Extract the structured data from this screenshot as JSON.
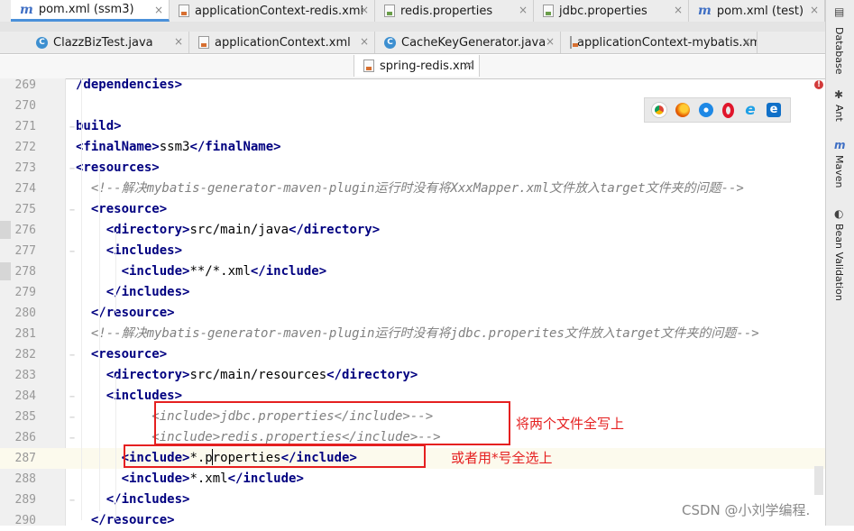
{
  "tabs_row1": [
    {
      "label": "pom.xml (ssm3)",
      "icon": "maven-m-icon",
      "active": true
    },
    {
      "label": "applicationContext-redis.xml",
      "icon": "xml-file-icon"
    },
    {
      "label": "redis.properties",
      "icon": "properties-file-icon"
    },
    {
      "label": "jdbc.properties",
      "icon": "properties-file-icon"
    },
    {
      "label": "pom.xml (test)",
      "icon": "maven-m-icon"
    }
  ],
  "tabs_row2": [
    {
      "label": "ClazzBizTest.java",
      "icon": "java-class-icon"
    },
    {
      "label": "applicationContext.xml",
      "icon": "xml-file-icon"
    },
    {
      "label": "CacheKeyGenerator.java",
      "icon": "java-class-icon"
    },
    {
      "label": "applicationContext-mybatis.xml",
      "icon": "xml-file-icon"
    }
  ],
  "tabs_row3": [
    {
      "label": "spring-redis.xml",
      "icon": "xml-file-icon"
    }
  ],
  "sidebar": {
    "database": "Database",
    "ant": "Ant",
    "maven": "Maven",
    "bean_validation": "Bean Validation"
  },
  "code_lines": [
    {
      "n": "269",
      "segs": [
        {
          "t": "tag",
          "v": "/dependencies>"
        }
      ]
    },
    {
      "n": "270",
      "segs": []
    },
    {
      "n": "271",
      "segs": [
        {
          "t": "tag",
          "v": "build>"
        }
      ]
    },
    {
      "n": "272",
      "segs": [
        {
          "t": "tag",
          "v": "<finalName>"
        },
        {
          "t": "txt",
          "v": "ssm3"
        },
        {
          "t": "tag",
          "v": "</finalName>"
        }
      ]
    },
    {
      "n": "273",
      "segs": [
        {
          "t": "tag",
          "v": "<resources>"
        }
      ]
    },
    {
      "n": "274",
      "segs": [
        {
          "t": "cmt",
          "v": "  <!--解决mybatis-generator-maven-plugin运行时没有将XxxMapper.xml文件放入target文件夹的问题-->"
        }
      ]
    },
    {
      "n": "275",
      "segs": [
        {
          "t": "txt",
          "v": "  "
        },
        {
          "t": "tag",
          "v": "<resource>"
        }
      ]
    },
    {
      "n": "276",
      "segs": [
        {
          "t": "txt",
          "v": "    "
        },
        {
          "t": "tag",
          "v": "<directory>"
        },
        {
          "t": "txt",
          "v": "src/main/java"
        },
        {
          "t": "tag",
          "v": "</directory>"
        }
      ]
    },
    {
      "n": "277",
      "segs": [
        {
          "t": "txt",
          "v": "    "
        },
        {
          "t": "tag",
          "v": "<includes>"
        }
      ]
    },
    {
      "n": "278",
      "segs": [
        {
          "t": "txt",
          "v": "      "
        },
        {
          "t": "tag",
          "v": "<include>"
        },
        {
          "t": "txt",
          "v": "**/*.xml"
        },
        {
          "t": "tag",
          "v": "</include>"
        }
      ]
    },
    {
      "n": "279",
      "segs": [
        {
          "t": "txt",
          "v": "    "
        },
        {
          "t": "tag",
          "v": "</includes>"
        }
      ]
    },
    {
      "n": "280",
      "segs": [
        {
          "t": "txt",
          "v": "  "
        },
        {
          "t": "tag",
          "v": "</resource>"
        }
      ]
    },
    {
      "n": "281",
      "segs": [
        {
          "t": "cmt",
          "v": "  <!--解决mybatis-generator-maven-plugin运行时没有将jdbc.properites文件放入target文件夹的问题-->"
        }
      ]
    },
    {
      "n": "282",
      "segs": [
        {
          "t": "txt",
          "v": "  "
        },
        {
          "t": "tag",
          "v": "<resource>"
        }
      ]
    },
    {
      "n": "283",
      "segs": [
        {
          "t": "txt",
          "v": "    "
        },
        {
          "t": "tag",
          "v": "<directory>"
        },
        {
          "t": "txt",
          "v": "src/main/resources"
        },
        {
          "t": "tag",
          "v": "</directory>"
        }
      ]
    },
    {
      "n": "284",
      "segs": [
        {
          "t": "txt",
          "v": "    "
        },
        {
          "t": "tag",
          "v": "<includes>"
        }
      ]
    },
    {
      "n": "285",
      "segs": [
        {
          "t": "cmt",
          "v": "          <include>jdbc.properties</include>-->"
        }
      ]
    },
    {
      "n": "286",
      "segs": [
        {
          "t": "cmt",
          "v": "          <include>redis.properties</include>-->"
        }
      ]
    },
    {
      "n": "287",
      "segs": [
        {
          "t": "txt",
          "v": "      "
        },
        {
          "t": "tag",
          "v": "<include>"
        },
        {
          "t": "txt",
          "v": "*.properties"
        },
        {
          "t": "tag",
          "v": "</include>"
        }
      ]
    },
    {
      "n": "288",
      "segs": [
        {
          "t": "txt",
          "v": "      "
        },
        {
          "t": "tag",
          "v": "<include>"
        },
        {
          "t": "txt",
          "v": "*.xml"
        },
        {
          "t": "tag",
          "v": "</include>"
        }
      ]
    },
    {
      "n": "289",
      "segs": [
        {
          "t": "txt",
          "v": "    "
        },
        {
          "t": "tag",
          "v": "</includes>"
        }
      ]
    },
    {
      "n": "290",
      "segs": [
        {
          "t": "txt",
          "v": "  "
        },
        {
          "t": "tag",
          "v": "</resource>"
        }
      ]
    }
  ],
  "annotations": {
    "note1": "将两个文件全写上",
    "note2": "或者用*号全选上"
  },
  "watermark": "CSDN @小刘学编程.",
  "colors": {
    "tag": "#000080",
    "comment": "#808080",
    "annotation": "#e52020",
    "active_tab": "#4a90d9"
  }
}
